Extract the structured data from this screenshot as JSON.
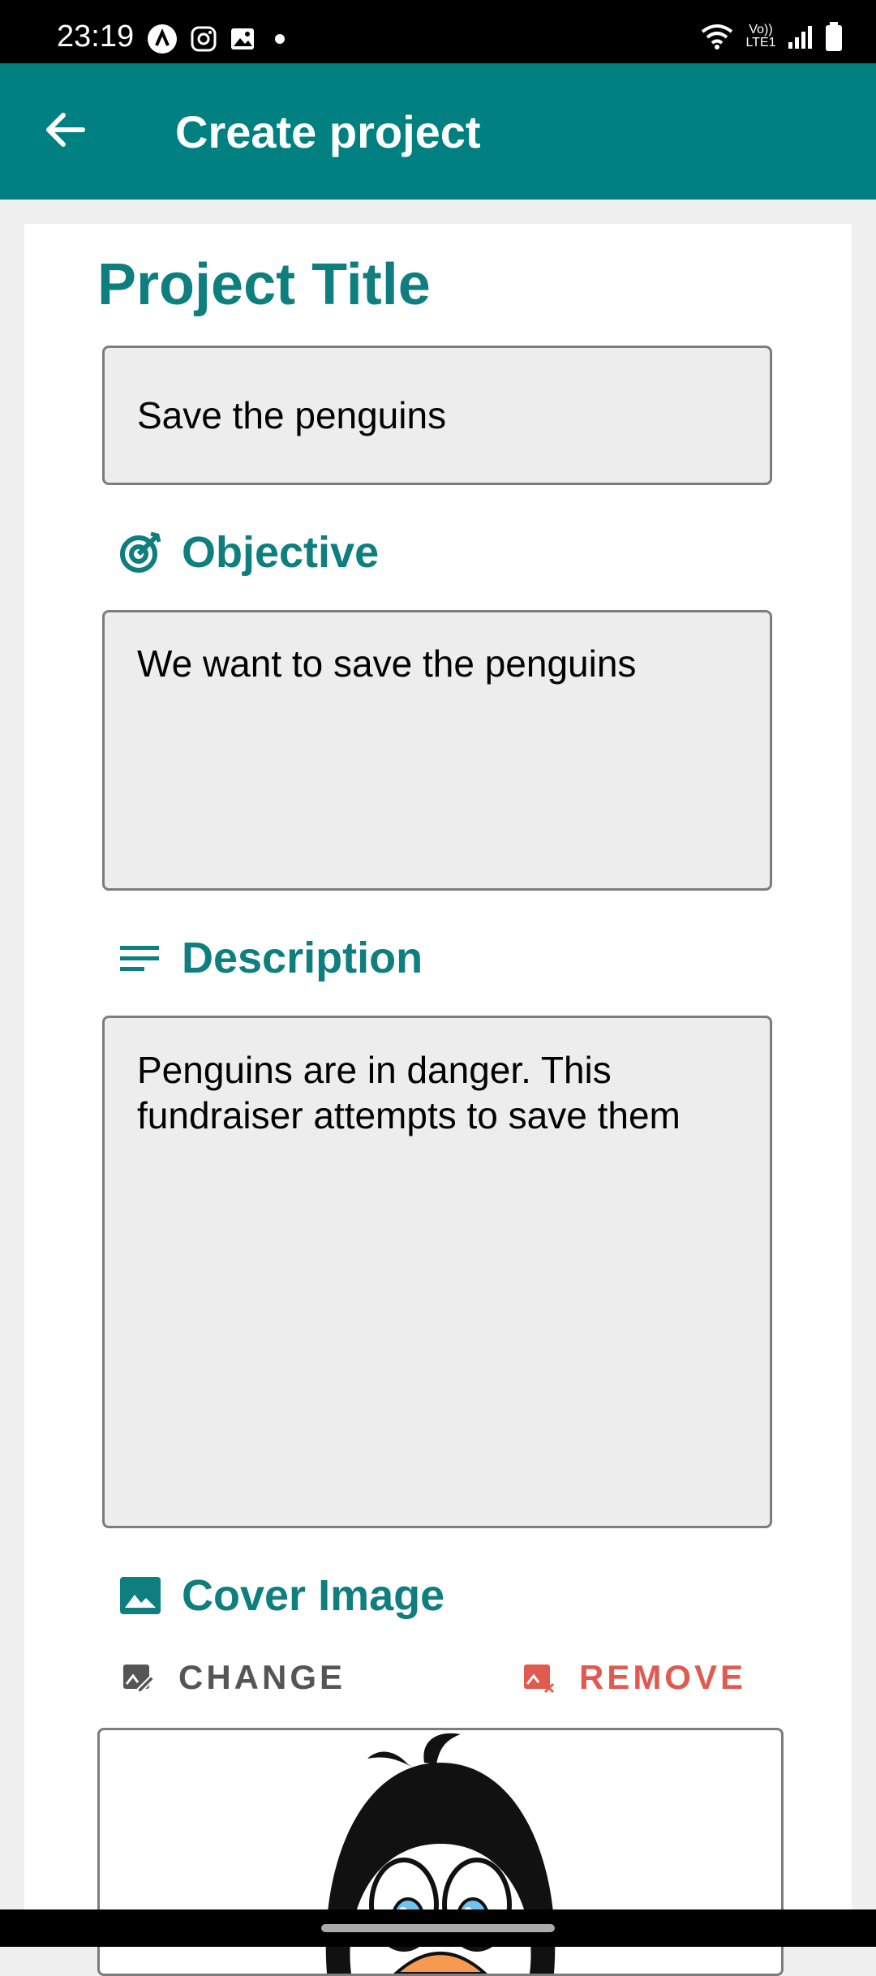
{
  "status_bar": {
    "time": "23:19",
    "notification_icons": [
      "a-logo-icon",
      "instagram-icon",
      "image-icon",
      "dot-icon"
    ],
    "system_icons": [
      "wifi-icon",
      "volte-icon",
      "signal-icon",
      "battery-icon"
    ],
    "volte_label": "Vo)) LTE1"
  },
  "app_bar": {
    "title": "Create project",
    "back_icon": "arrow-back-icon",
    "color": "#008080"
  },
  "form": {
    "project_title_label": "Project Title",
    "project_title_value": "Save the penguins",
    "objective_label": "Objective",
    "objective_icon": "target-icon",
    "objective_value": "We want to save the penguins",
    "description_label": "Description",
    "description_icon": "notes-icon",
    "description_value": "Penguins are in danger. This fundraiser attempts to save them",
    "cover_image_label": "Cover Image",
    "cover_image_icon": "image-icon",
    "change_label": "CHANGE",
    "remove_label": "REMOVE",
    "accent_color": "#0e7e7e",
    "remove_color": "#e05a50"
  }
}
